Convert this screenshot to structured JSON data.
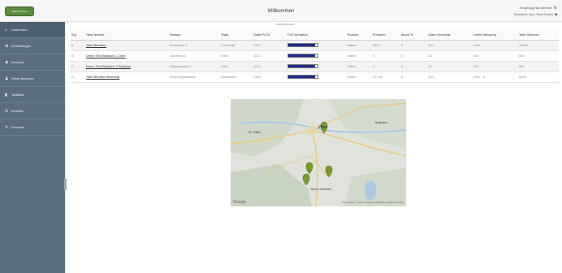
{
  "header": {
    "logo_text": "NETZ-TECH",
    "title": "Willkommen",
    "user_line1": "Eingeloggt als sbernet",
    "user_line2": "Standard: Neu-Tech GmbH"
  },
  "sidebar": {
    "items": [
      {
        "icon": "home-icon",
        "glyph": "⌂",
        "label": "Dashboard"
      },
      {
        "icon": "settings-icon",
        "glyph": "⚙",
        "label": "Einstellungen"
      },
      {
        "icon": "user-icon",
        "glyph": "♟",
        "label": "Benutzer"
      },
      {
        "icon": "add-user-icon",
        "glyph": "♟",
        "label": "Neuer Benutzer"
      },
      {
        "icon": "chart-icon",
        "glyph": "▮",
        "label": "Tankliste"
      },
      {
        "icon": "refresh-icon",
        "glyph": "↻",
        "label": "Berichte"
      },
      {
        "icon": "pencil-icon",
        "glyph": "✎",
        "label": "Produkte"
      }
    ]
  },
  "table": {
    "columns": [
      "ID#",
      "Tank Name#",
      "Strasse",
      "Stadt",
      "Stadt PLZ#",
      "Füll Verhältnis",
      "Produkt",
      "Freiraum",
      "Alarm %",
      "Alarm Schwelle",
      "Letzte Messung",
      "Tank Volumen"
    ],
    "rows": [
      {
        "id": "A",
        "name": "Tank Beutisch",
        "street": "Autohweg 3",
        "city": "Loderwalf",
        "plz": "2344",
        "fill": 0.92,
        "product": "Water",
        "free": "5323",
        "alarm_pct": "5",
        "alarm_threshold": "500",
        "last": "4000",
        "volume": "10000"
      },
      {
        "id": "B",
        "name": "Demo Test Beutisch 2 Ober",
        "street": "Schiering 1",
        "city": "Wien",
        "plz": "1010",
        "fill": 0.92,
        "product": "Water",
        "free": "0",
        "alarm_pct": "5",
        "alarm_threshold": "25",
        "last": "500",
        "volume": "500"
      },
      {
        "id": "C",
        "name": "Demo Test Beutisch 3 Rathaus",
        "street": "Rathausplatz 1",
        "city": "Wien",
        "plz": "1010",
        "fill": 0.92,
        "product": "Water",
        "free": "0",
        "alarm_pct": "5",
        "alarm_threshold": "25",
        "last": "500",
        "volume": "500"
      },
      {
        "id": "D",
        "name": "Tank Beutisch Bisching",
        "street": "Fischingasstrasse",
        "city": "Birsbisdorf",
        "plz": "2460",
        "fill": 0.92,
        "product": "Water",
        "free": "477.55",
        "alarm_pct": "5",
        "alarm_threshold": "150",
        "last": "2022 - 2",
        "volume": "5000"
      }
    ]
  },
  "map": {
    "logo": "Google",
    "credit": "Kartendaten © 2017 GeoBasis-DE/BKG (©2009), Google",
    "labels": [
      "Wien",
      "St. Pölten",
      "Wiener Neustadt",
      "Bratislava"
    ]
  },
  "colors": {
    "sidebar_bg": "#596f7f",
    "fill_bar": "#1e2b8f",
    "logo_green": "#5b8a3c"
  }
}
